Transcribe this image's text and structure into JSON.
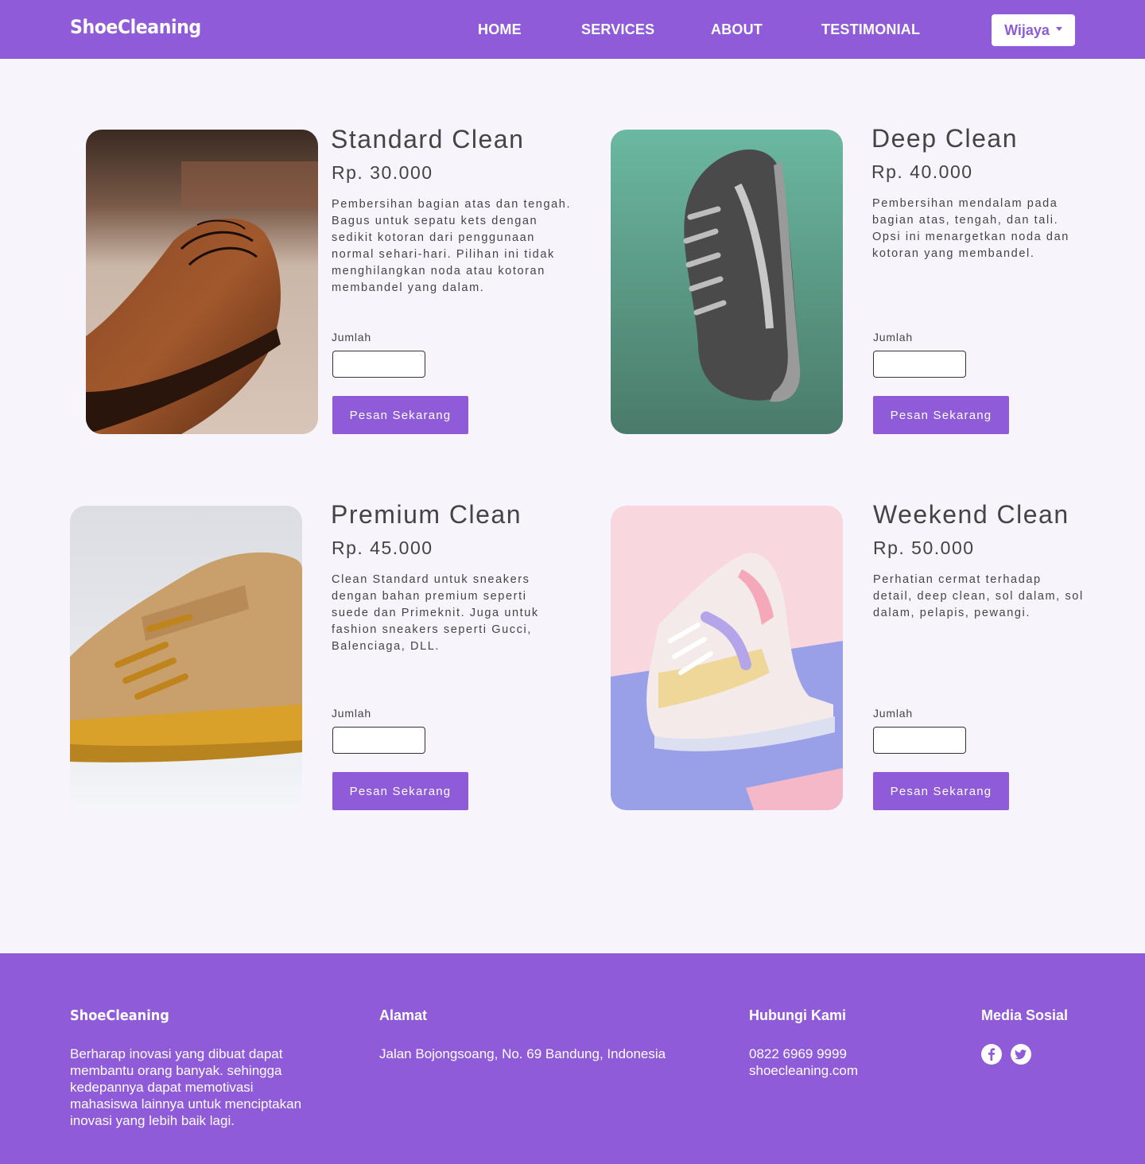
{
  "navbar": {
    "brand": "ShoeCleaning",
    "links": [
      "HOME",
      "SERVICES",
      "ABOUT",
      "TESTIMONIAL"
    ],
    "user": "Wijaya"
  },
  "services": [
    {
      "title": "Standard Clean",
      "price": "Rp. 30.000",
      "description": "Pembersihan bagian atas dan tengah. Bagus untuk sepatu kets dengan sedikit kotoran dari penggunaan normal sehari-hari. Pilihan ini tidak menghilangkan noda atau kotoran membandel yang dalam.",
      "qty_label": "Jumlah",
      "qty_value": "",
      "button": "Pesan Sekarang"
    },
    {
      "title": "Deep Clean",
      "price": "Rp. 40.000",
      "description": "Pembersihan mendalam pada bagian atas, tengah, dan tali. Opsi ini menargetkan noda dan kotoran yang membandel.",
      "qty_label": "Jumlah",
      "qty_value": "",
      "button": "Pesan Sekarang"
    },
    {
      "title": "Premium Clean",
      "price": "Rp. 45.000",
      "description": "Clean Standard untuk sneakers dengan bahan premium seperti suede dan Primeknit. Juga untuk fashion sneakers seperti Gucci, Balenciaga, DLL.",
      "qty_label": "Jumlah",
      "qty_value": "",
      "button": "Pesan Sekarang"
    },
    {
      "title": "Weekend Clean",
      "price": "Rp. 50.000",
      "description": "Perhatian cermat terhadap detail, deep clean, sol dalam, sol dalam, pelapis, pewangi.",
      "qty_label": "Jumlah",
      "qty_value": "",
      "button": "Pesan Sekarang"
    }
  ],
  "footer": {
    "brand": "ShoeCleaning",
    "tagline": "Berharap inovasi yang dibuat dapat membantu orang banyak. sehingga kedepannya dapat memotivasi mahasiswa lainnya untuk menciptakan inovasi yang lebih baik lagi.",
    "address_heading": "Alamat",
    "address": "Jalan Bojongsoang, No. 69 Bandung, Indonesia",
    "contact_heading": "Hubungi Kami",
    "phone": "0822 6969 9999",
    "website": "shoecleaning.com",
    "social_heading": "Media Sosial",
    "social_icons": [
      "facebook-icon",
      "twitter-icon"
    ]
  },
  "colors": {
    "accent": "#8f5bd8",
    "background": "#f7f5fb",
    "text": "#444444"
  }
}
